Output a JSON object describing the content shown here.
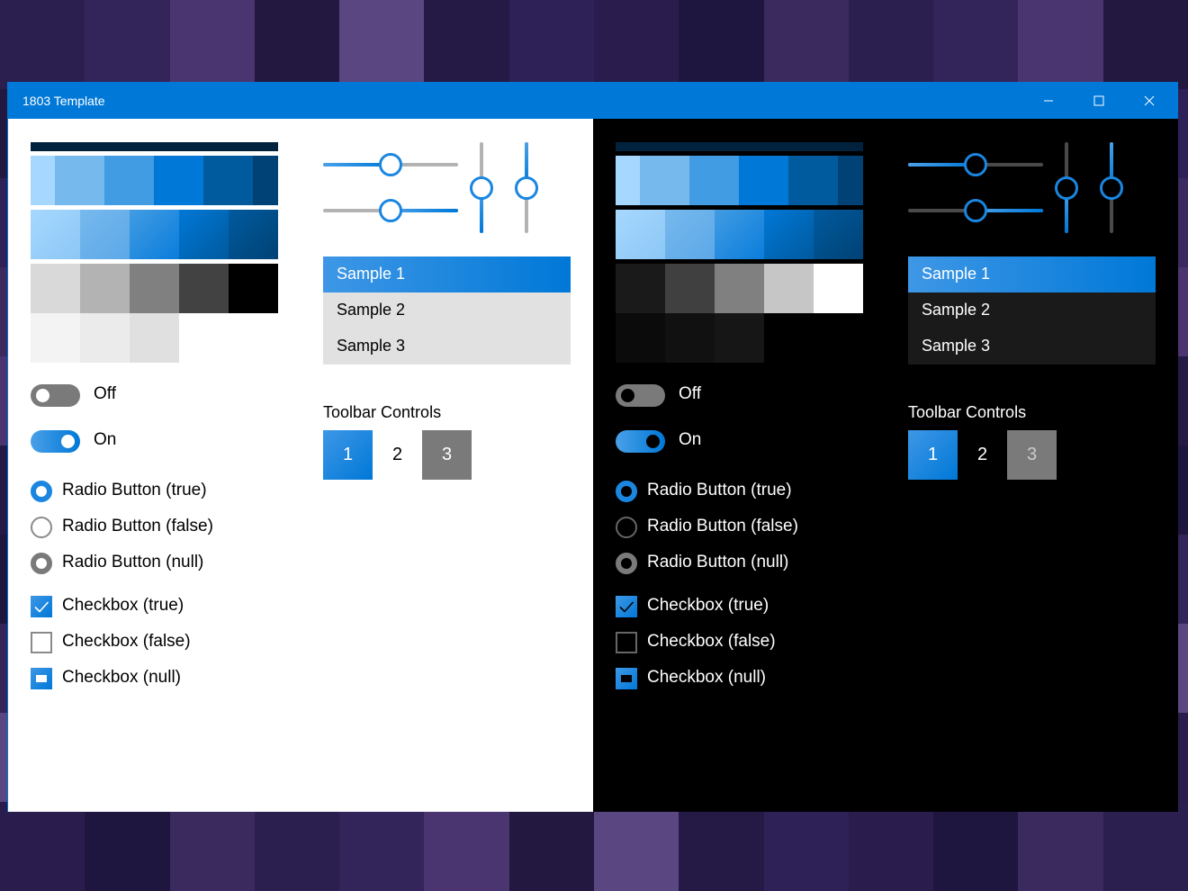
{
  "window": {
    "title": "1803 Template",
    "minimize": "—",
    "maximize": "☐",
    "close": "✕"
  },
  "colors": {
    "accent": "#0078d7",
    "title_bar": "#0078d7",
    "accent_dark": "#00223d",
    "accent_row": [
      "#a6d8ff",
      "#76b9ed",
      "#429ce3",
      "#0078d7",
      "#005a9e",
      "#004275"
    ],
    "light_grays": [
      "#d9d9d9",
      "#b3b3b3",
      "#808080",
      "#424242",
      "#000000"
    ],
    "light_grays2": [
      "#f3f3f3",
      "#ebebeb",
      "#e0e0e0"
    ],
    "dark_grays": [
      "#1a1a1a",
      "#404040",
      "#808080",
      "#c6c6c6",
      "#ffffff"
    ],
    "dark_grays2": [
      "#0b0b0b",
      "#111111",
      "#161616"
    ]
  },
  "panels": {
    "light": {
      "list": [
        "Sample 1",
        "Sample 2",
        "Sample 3"
      ],
      "toolbar_label": "Toolbar Controls",
      "toolbar": [
        "1",
        "2",
        "3"
      ],
      "toggle_off": "Off",
      "toggle_on": "On",
      "radios": [
        "Radio Button (true)",
        "Radio Button (false)",
        "Radio Button (null)"
      ],
      "checkboxes": [
        "Checkbox (true)",
        "Checkbox (false)",
        "Checkbox (null)"
      ],
      "sliders": {
        "h1": 50,
        "h2": 50,
        "v1": 50,
        "v2": 50
      }
    },
    "dark": {
      "list": [
        "Sample 1",
        "Sample 2",
        "Sample 3"
      ],
      "toolbar_label": "Toolbar Controls",
      "toolbar": [
        "1",
        "2",
        "3"
      ],
      "toggle_off": "Off",
      "toggle_on": "On",
      "radios": [
        "Radio Button (true)",
        "Radio Button (false)",
        "Radio Button (null)"
      ],
      "checkboxes": [
        "Checkbox (true)",
        "Checkbox (false)",
        "Checkbox (null)"
      ],
      "sliders": {
        "h1": 50,
        "h2": 50,
        "v1": 50,
        "v2": 50
      }
    }
  }
}
